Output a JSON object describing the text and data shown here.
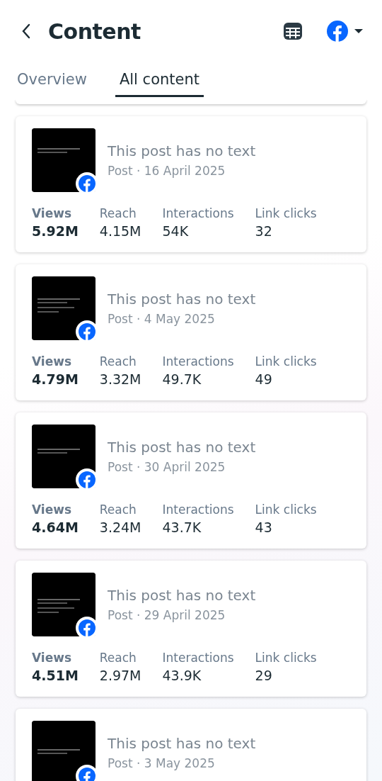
{
  "header": {
    "title": "Content"
  },
  "tabs": [
    {
      "label": "Overview",
      "selected": false
    },
    {
      "label": "All content",
      "selected": true
    }
  ],
  "posts": [
    {
      "title": "This post has no text",
      "meta": "Post · 16 April 2025",
      "metrics": [
        {
          "label": "Views",
          "value": "5.92M"
        },
        {
          "label": "Reach",
          "value": "4.15M"
        },
        {
          "label": "Interactions",
          "value": "54K"
        },
        {
          "label": "Link clicks",
          "value": "32"
        }
      ]
    },
    {
      "title": "This post has no text",
      "meta": "Post · 4 May 2025",
      "metrics": [
        {
          "label": "Views",
          "value": "4.79M"
        },
        {
          "label": "Reach",
          "value": "3.32M"
        },
        {
          "label": "Interactions",
          "value": "49.7K"
        },
        {
          "label": "Link clicks",
          "value": "49"
        }
      ]
    },
    {
      "title": "This post has no text",
      "meta": "Post · 30 April 2025",
      "metrics": [
        {
          "label": "Views",
          "value": "4.64M"
        },
        {
          "label": "Reach",
          "value": "3.24M"
        },
        {
          "label": "Interactions",
          "value": "43.7K"
        },
        {
          "label": "Link clicks",
          "value": "43"
        }
      ]
    },
    {
      "title": "This post has no text",
      "meta": "Post · 29 April 2025",
      "metrics": [
        {
          "label": "Views",
          "value": "4.51M"
        },
        {
          "label": "Reach",
          "value": "2.97M"
        },
        {
          "label": "Interactions",
          "value": "43.9K"
        },
        {
          "label": "Link clicks",
          "value": "29"
        }
      ]
    },
    {
      "title": "This post has no text",
      "meta": "Post · 3 May 2025"
    }
  ]
}
